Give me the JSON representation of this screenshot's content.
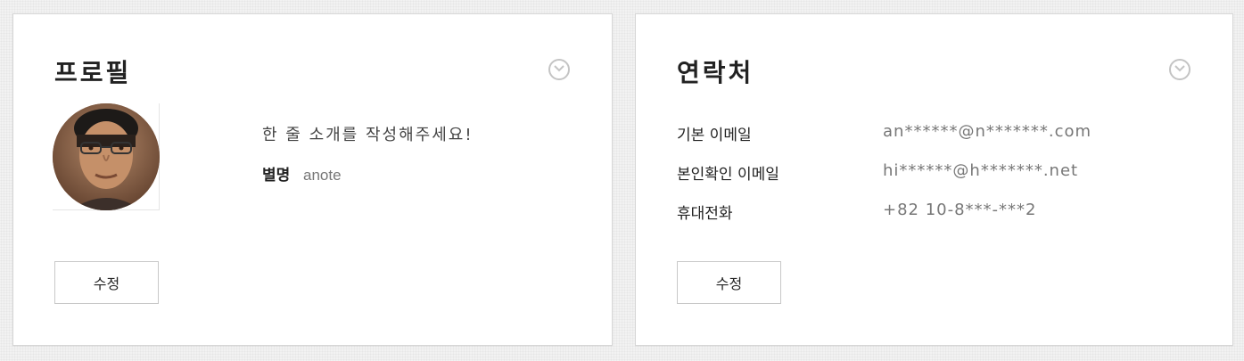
{
  "profile": {
    "title": "프로필",
    "intro": "한 줄 소개를 작성해주세요!",
    "nickname_label": "별명",
    "nickname_value": "anote",
    "edit_label": "수정"
  },
  "contact": {
    "title": "연락처",
    "rows": [
      {
        "label": "기본 이메일",
        "value": "an******@n*******.com"
      },
      {
        "label": "본인확인 이메일",
        "value": "hi******@h*******.net"
      },
      {
        "label": "휴대전화",
        "value": "+82 10-8***-***2"
      }
    ],
    "edit_label": "수정"
  },
  "icons": {
    "toggle": "chevron-down-circle-icon",
    "avatar": "user-photo"
  },
  "colors": {
    "background": "#f2f2f2",
    "card": "#ffffff",
    "border": "#d6d6d6",
    "muted_text": "#777777"
  }
}
